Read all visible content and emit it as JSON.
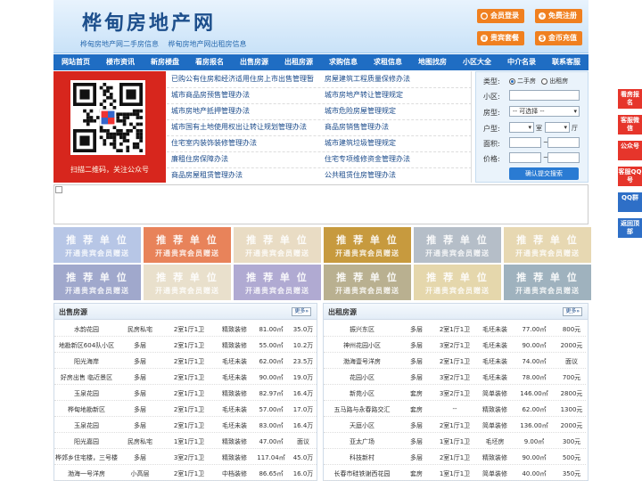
{
  "header": {
    "title": "桦甸房地产网",
    "subtitle_links": [
      "桦甸房地产网二手房信息",
      "桦甸房地产网出租房信息"
    ],
    "buttons": [
      {
        "label": "会员登录",
        "icon": "user-icon"
      },
      {
        "label": "免费注册",
        "icon": "user-plus-icon"
      },
      {
        "label": "贵宾套餐",
        "icon": "crown-icon"
      },
      {
        "label": "金币充值",
        "icon": "coin-icon"
      }
    ]
  },
  "nav": [
    "网站首页",
    "楼市资讯",
    "新房楼盘",
    "看房报名",
    "出售房源",
    "出租房源",
    "求购信息",
    "求租信息",
    "地图找房",
    "小区大全",
    "中介名录",
    "联系客服"
  ],
  "qr": {
    "caption": "扫描二维码，关注公众号"
  },
  "links": {
    "left": [
      "已购公有住房和经济适用住房上市出售管理暂",
      "城市商品房预售管理办法",
      "城市房地产抵押管理办法",
      "城市国有土地使用权出让转让规划管理办法",
      "住宅室内装饰装修管理办法",
      "廉租住房保障办法",
      "商品房屋租赁管理办法"
    ],
    "right": [
      "房屋建筑工程质量保修办法",
      "城市房地产转让管理规定",
      "城市危险房屋管理规定",
      "商品房销售管理办法",
      "城市建筑垃圾管理规定",
      "住宅专项维修资金管理办法",
      "公共租赁住房管理办法"
    ]
  },
  "search": {
    "type_label": "类型:",
    "type_options": [
      "二手房",
      "出租房"
    ],
    "community_label": "小区:",
    "house_type_label": "房型:",
    "house_type_value": "-- 可选择 --",
    "layout_label": "户型:",
    "room_unit": "室",
    "hall_unit": "厅",
    "area_label": "面积:",
    "price_label": "价格:",
    "range_sep": "~",
    "submit": "确认提交搜索"
  },
  "ads": {
    "line1": "推 荐 单 位",
    "line2": "开通贵宾会员赠送",
    "colors": [
      [
        "#b7c6e6",
        "#e8835a",
        "#e9dcc4",
        "#c79a3e",
        "#b5bec8",
        "#e7d8b2"
      ],
      [
        "#a0a8cc",
        "#e9e0cc",
        "#b0aad2",
        "#b9b090",
        "#e5d7ac",
        "#9fb2be"
      ]
    ]
  },
  "side": [
    {
      "label": "看房报名",
      "color": "red"
    },
    {
      "label": "客服微信",
      "color": "red"
    },
    {
      "label": "公众号",
      "color": "red"
    },
    {
      "label": "客服QQ号",
      "color": "red"
    },
    {
      "label": "QQ群",
      "color": "blue"
    },
    {
      "label": "返回顶部",
      "color": "blue"
    }
  ],
  "sale": {
    "title": "出售房源",
    "more": "更多»",
    "rows": [
      [
        "水韵花园",
        "民房私宅",
        "2室1厅1卫",
        "精致装修",
        "81.00㎡",
        "35.0万"
      ],
      [
        "地勘新区604队小区",
        "多层",
        "2室1厅1卫",
        "精致装修",
        "55.00㎡",
        "10.2万"
      ],
      [
        "阳光海岸",
        "多层",
        "2室1厅1卫",
        "毛坯未装",
        "62.00㎡",
        "23.5万"
      ],
      [
        "好房出售 临近景区",
        "多层",
        "2室1厅1卫",
        "毛坯未装",
        "90.00㎡",
        "19.0万"
      ],
      [
        "玉泉花园",
        "多层",
        "2室1厅1卫",
        "精致装修",
        "82.97㎡",
        "16.4万"
      ],
      [
        "桦甸地勘新区",
        "多层",
        "2室1厅1卫",
        "毛坯未装",
        "57.00㎡",
        "17.0万"
      ],
      [
        "玉泉花园",
        "多层",
        "2室1厅1卫",
        "毛坯未装",
        "83.00㎡",
        "16.4万"
      ],
      [
        "阳光嘉园",
        "民房私宅",
        "1室1厅1卫",
        "精致装修",
        "47.00㎡",
        "面议"
      ],
      [
        "桦郊乡住宅楼，三号楼",
        "多层",
        "3室2厅1卫",
        "精致装修",
        "117.04㎡",
        "45.0万"
      ],
      [
        "渤海一号洋房",
        "小高层",
        "2室1厅1卫",
        "中档装修",
        "86.65㎡",
        "16.0万"
      ]
    ]
  },
  "rent": {
    "title": "出租房源",
    "more": "更多»",
    "rows": [
      [
        "振兴东区",
        "多层",
        "2室1厅1卫",
        "毛坯未装",
        "77.00㎡",
        "800元"
      ],
      [
        "神州花园小区",
        "多层",
        "3室2厅1卫",
        "毛坯未装",
        "90.00㎡",
        "2000元"
      ],
      [
        "渤海壹号洋房",
        "多层",
        "2室1厅1卫",
        "毛坯未装",
        "74.00㎡",
        "面议"
      ],
      [
        "花园小区",
        "多层",
        "3室2厅1卫",
        "毛坯未装",
        "78.00㎡",
        "700元"
      ],
      [
        "新苑小区",
        "套房",
        "3室2厅1卫",
        "简单装修",
        "146.00㎡",
        "2800元"
      ],
      [
        "五马路与永春路交汇",
        "套房",
        "--",
        "精致装修",
        "62.00㎡",
        "1300元"
      ],
      [
        "天庭小区",
        "多层",
        "2室1厅1卫",
        "简单装修",
        "136.00㎡",
        "2000元"
      ],
      [
        "亚太广场",
        "多层",
        "1室1厅1卫",
        "毛坯房",
        "9.00㎡",
        "300元"
      ],
      [
        "科技新村",
        "多层",
        "2室1厅1卫",
        "精致装修",
        "90.00㎡",
        "500元"
      ],
      [
        "长春市硅铁谢西花园",
        "套房",
        "1室1厅1卫",
        "简单装修",
        "40.00㎡",
        "350元"
      ]
    ]
  }
}
